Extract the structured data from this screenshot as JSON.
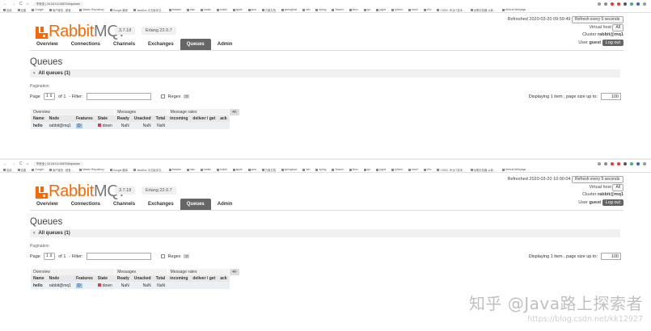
{
  "browser": {
    "nav_icons": [
      "←",
      "→",
      "C",
      "⌂"
    ],
    "url": "不安全 | 10.18.0.4:15672/#/queues",
    "bookmarks": [
      "应用",
      "百度",
      "Google",
      "用户服务 - 超音 ...",
      "Maven Repository",
      "Google 翻译",
      "JavaDoc 中文版本汉...",
      "framew",
      "mac",
      "nodes",
      "toolkit",
      "apple",
      "java",
      "方案文档",
      "springboot",
      "ssh",
      "spring",
      "Search",
      "linux",
      "spr",
      "jsgrid",
      "iphone",
      "excel",
      "vSo",
      "CSDN -专业IT技术...",
      "谷歌浏览器-从新 ...",
      "Vertical Webpage ..."
    ]
  },
  "shots": [
    {
      "refreshed": "Refreshed 2020-03-20 09:59:49",
      "refresh_select": "Refresh every 5 seconds",
      "vhost_label": "Virtual host",
      "vhost_value": "All",
      "cluster_label": "Cluster",
      "cluster_value": "rabbit@mq1",
      "user_label": "User",
      "user_value": "guest",
      "logout": "Log out"
    },
    {
      "refreshed": "Refreshed 2020-03-20 10:00:04",
      "refresh_select": "Refresh every 5 seconds",
      "vhost_label": "Virtual host",
      "vhost_value": "All",
      "cluster_label": "Cluster",
      "cluster_value": "rabbit@mq1",
      "user_label": "User",
      "user_value": "guest",
      "logout": "Log out"
    }
  ],
  "header": {
    "logo_rabbit": "Rabbit",
    "logo_mq": "MQ.",
    "version": "3.7.18",
    "erlang": "Erlang 22.0.7"
  },
  "tabs": [
    "Overview",
    "Connections",
    "Channels",
    "Exchanges",
    "Queues",
    "Admin"
  ],
  "content": {
    "title": "Queues",
    "section": "All queues (1)",
    "pagination_label": "Pagination",
    "page_label": "Page",
    "page_value": "1",
    "of_label": "of 1",
    "filter_label": "- Filter:",
    "regex_label": "Regex",
    "regex_help": "?",
    "display_text": "Displaying 1 item , page size up to:",
    "page_size": "100"
  },
  "table": {
    "groups": [
      "Overview",
      "Messages",
      "Message rates",
      "+/-"
    ],
    "columns": [
      "Name",
      "Node",
      "Features",
      "State",
      "Ready",
      "Unacked",
      "Total",
      "incoming",
      "deliver / get",
      "ack"
    ],
    "row": {
      "name": "hello",
      "node": "rabbit@mq1",
      "feature": "D",
      "state": "down",
      "ready": "NaN",
      "unacked": "NaN",
      "total": "NaN",
      "incoming": "",
      "deliver": "",
      "ack": ""
    }
  },
  "watermark": {
    "main": "知乎 @Java路上探索者",
    "sub": "https://blog.csdn.net/kk12927"
  }
}
